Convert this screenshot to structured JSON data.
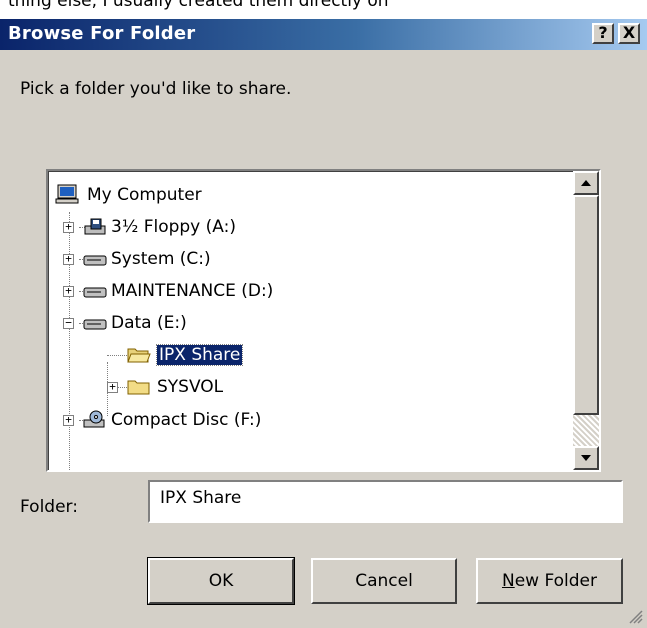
{
  "background_text": "thing else, I usually created them directly on",
  "dialog": {
    "title": "Browse For Folder",
    "help_label": "?",
    "close_label": "X",
    "instruction": "Pick a folder you'd like to share.",
    "tree": {
      "root": "My Computer",
      "items": [
        {
          "label": "3½ Floppy (A:)",
          "icon": "floppy-drive-icon",
          "expander": "+"
        },
        {
          "label": "System (C:)",
          "icon": "hard-drive-icon",
          "expander": "+"
        },
        {
          "label": "MAINTENANCE (D:)",
          "icon": "hard-drive-icon",
          "expander": "+"
        },
        {
          "label": "Data (E:)",
          "icon": "hard-drive-icon",
          "expander": "−"
        },
        {
          "label": "IPX Share",
          "icon": "open-folder-icon",
          "selected": true
        },
        {
          "label": "SYSVOL",
          "icon": "folder-icon",
          "expander": "+"
        },
        {
          "label": "Compact Disc (F:)",
          "icon": "cd-drive-icon",
          "expander": "+"
        }
      ]
    },
    "folder_label": "Folder:",
    "folder_value": "IPX Share",
    "buttons": {
      "ok": "OK",
      "cancel": "Cancel",
      "new_folder_prefix": "N",
      "new_folder_rest": "ew Folder"
    }
  },
  "colors": {
    "title_start": "#0a246a",
    "title_end": "#a6caf0",
    "face": "#d4d0c8",
    "selection": "#0a246a"
  }
}
